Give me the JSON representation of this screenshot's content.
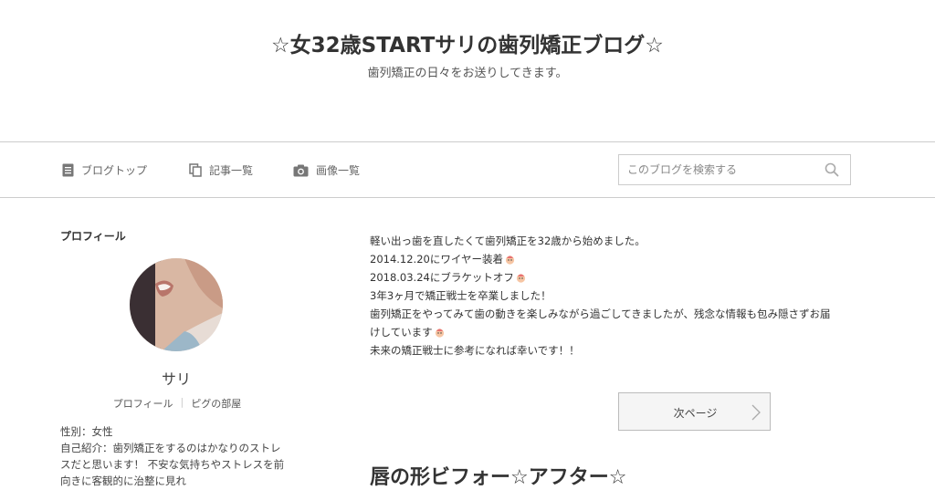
{
  "header": {
    "title": "☆女32歳STARTサリの歯列矯正ブログ☆",
    "description": "歯列矯正の日々をお送りしてきます。"
  },
  "nav": {
    "items": [
      {
        "label": "ブログトップ",
        "icon": "document-icon"
      },
      {
        "label": "記事一覧",
        "icon": "copy-icon"
      },
      {
        "label": "画像一覧",
        "icon": "camera-icon"
      }
    ],
    "search_placeholder": "このブログを検索する"
  },
  "sidebar": {
    "heading": "プロフィール",
    "name": "サリ",
    "links": [
      "プロフィール",
      "ピグの部屋"
    ],
    "bio_lines": [
      "性別：女性",
      "自己紹介：歯列矯正をするのはかなりのストレ",
      "スだと思います！ 不安な気持ちやストレスを前",
      "向きに客観的に治整に見れ"
    ]
  },
  "main": {
    "lines": [
      {
        "text": "軽い出っ歯を直したくて歯列矯正を32歳から始めました。",
        "emoji": false
      },
      {
        "text": "2014.12.20にワイヤー装着",
        "emoji": true
      },
      {
        "text": "2018.03.24にブラケットオフ",
        "emoji": true
      },
      {
        "text": "3年3ヶ月で矯正戦士を卒業しました！",
        "emoji": false
      },
      {
        "text": "歯列矯正をやってみて歯の動きを楽しみながら過ごしてきましたが、残念な情報も包み隠さずお届",
        "emoji": false
      },
      {
        "text": "けしています",
        "emoji": true
      },
      {
        "text": "未来の矯正戦士に参考になれば幸いです！！",
        "emoji": false
      }
    ],
    "next_label": "次ページ",
    "post_title": "唇の形ビフォー☆アフター☆"
  },
  "colors": {
    "border": "#cccccc",
    "text": "#333333",
    "button_bg": "#f5f5f5"
  }
}
